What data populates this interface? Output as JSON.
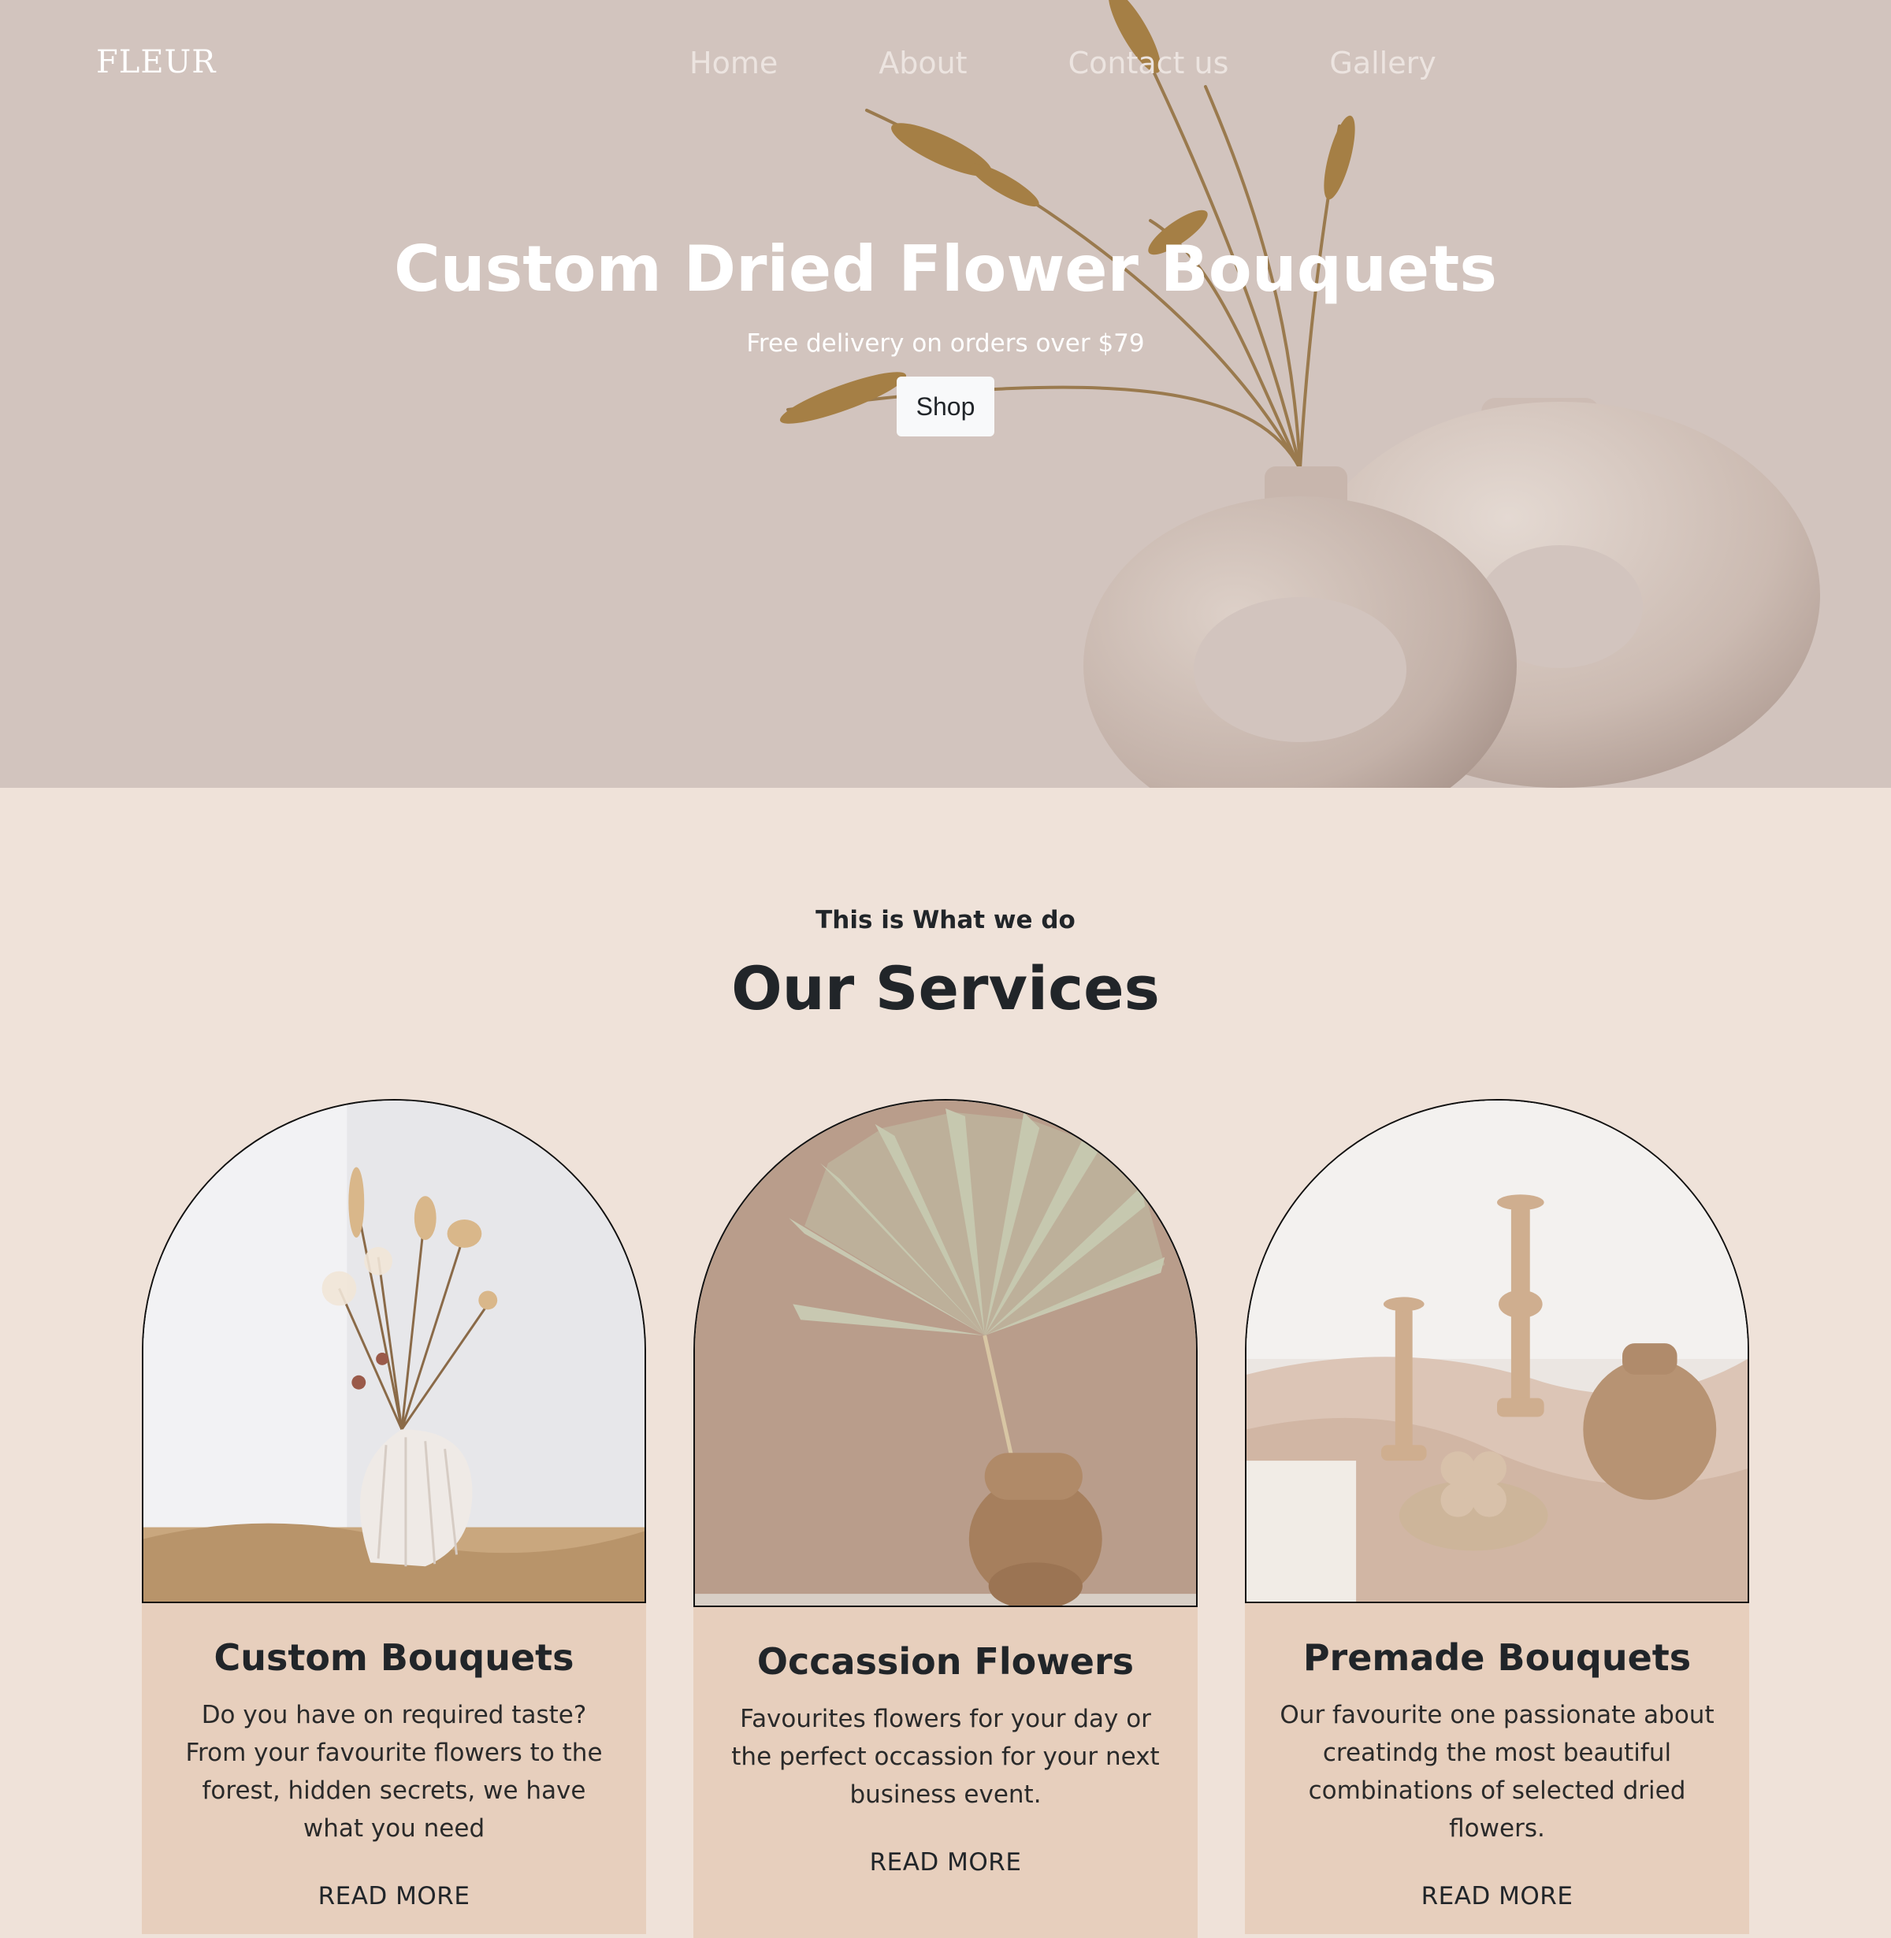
{
  "brand": {
    "logo": "FLEUR"
  },
  "nav": {
    "links": [
      "Home",
      "About",
      "Contact us",
      "Gallery"
    ]
  },
  "hero": {
    "title": "Custom Dried Flower Bouquets",
    "subtitle": "Free delivery on orders over $79",
    "cta_label": "Shop"
  },
  "services": {
    "eyebrow": "This is What we do",
    "title": "Our Services",
    "cards": [
      {
        "title": "Custom Bouquets",
        "text": "Do you have on required taste? From your favourite flowers to the forest, hidden secrets, we have what you need",
        "link": "READ MORE",
        "image": "shell-vase-dried-bouquet"
      },
      {
        "title": "Occassion Flowers",
        "text": "Favourites flowers for your day or the perfect occassion for your next business event.",
        "link": "READ MORE",
        "image": "palm-leaf-cork-vase"
      },
      {
        "title": "Premade Bouquets",
        "text": "Our favourite one passionate about creatindg the most beautiful combinations of selected dried flowers.",
        "link": "READ MORE",
        "image": "candles-and-vase-on-linen"
      }
    ]
  },
  "colors": {
    "hero_bg": "#d2c4be",
    "page_bg": "#efe2d9",
    "card_body": "#e7cfbd",
    "text": "#212529"
  }
}
